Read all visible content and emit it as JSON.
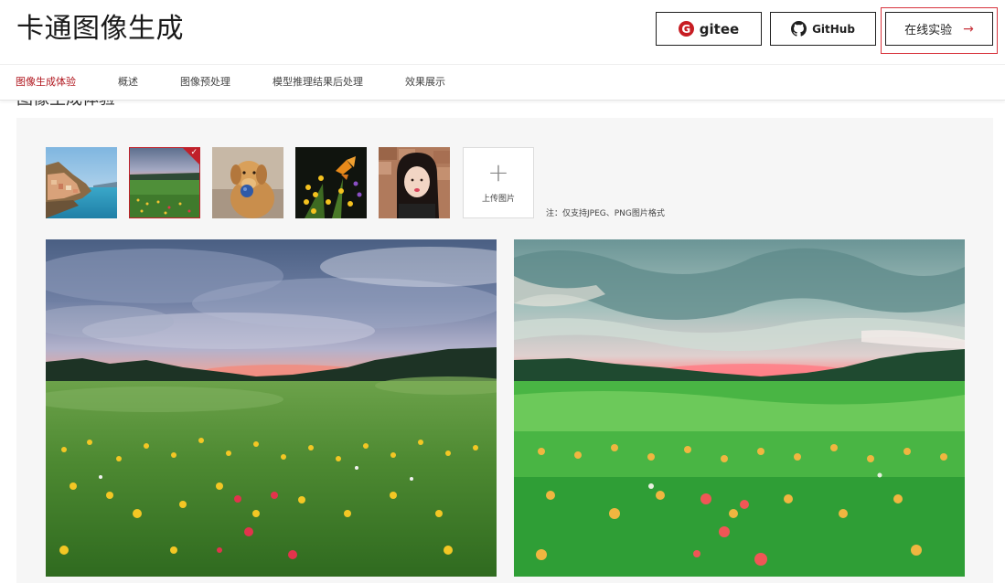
{
  "header": {
    "title": "卡通图像生成",
    "gitee_label": "gitee",
    "gitee_logo_letter": "G",
    "github_label": "GitHub",
    "try_label": "在线实验",
    "try_arrow": "→"
  },
  "nav": {
    "items": [
      {
        "label": "图像生成体验",
        "active": true
      },
      {
        "label": "概述",
        "active": false
      },
      {
        "label": "图像预处理",
        "active": false
      },
      {
        "label": "模型推理结果后处理",
        "active": false
      },
      {
        "label": "效果展示",
        "active": false
      }
    ]
  },
  "section": {
    "heading": "图像生成体验"
  },
  "demo": {
    "thumbnails": [
      {
        "subject": "coastal-town",
        "selected": false
      },
      {
        "subject": "wildflower-meadow",
        "selected": true
      },
      {
        "subject": "golden-retriever",
        "selected": false
      },
      {
        "subject": "butterfly-on-flowers",
        "selected": false
      },
      {
        "subject": "portrait-girl",
        "selected": false
      }
    ],
    "upload_icon": "+",
    "upload_label": "上传图片",
    "note": "注：仅支持JPEG、PNG图片格式",
    "original_image": "wildflower-meadow-photo",
    "result_image": "wildflower-meadow-cartoon"
  },
  "colors": {
    "accent": "#b0161e",
    "gitee_red": "#c71d23",
    "panel_bg": "#f6f6f6"
  }
}
